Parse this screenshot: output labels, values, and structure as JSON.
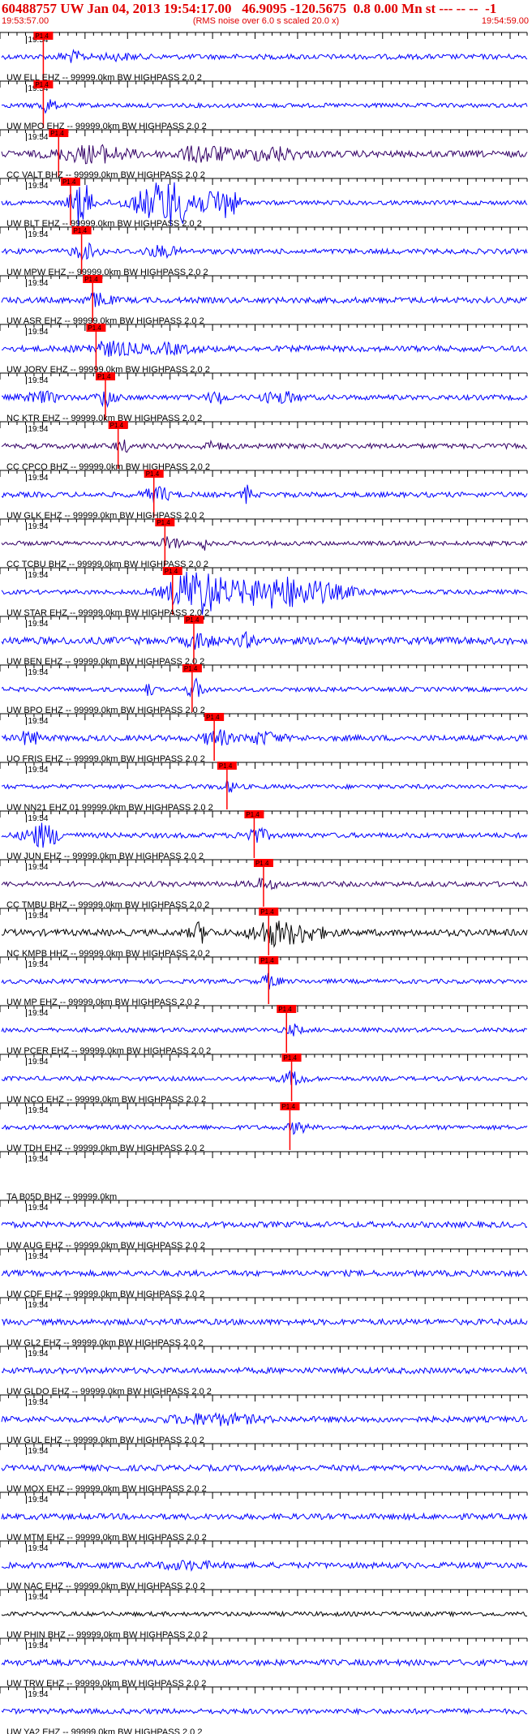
{
  "header": {
    "title": "60488757 UW Jan 04, 2013 19:54:17.00   46.9095 -120.5675  0.8 0.00 Mn st --- -- --  -1",
    "start_time": "19:53:57.00",
    "note": "(RMS noise over 6.0 s scaled 20.0 x)",
    "end_time": "19:54:59.00"
  },
  "colors": {
    "header_red": "#e00000",
    "trace_blue": "#0000ff",
    "trace_purple": "#330066",
    "trace_black": "#000000",
    "pick_red": "#ff0000"
  },
  "chart_data": {
    "type": "line",
    "x_range_seconds": [
      0,
      62
    ],
    "tick_label": "19:54",
    "pick_label": "P1.4",
    "traces": [
      {
        "label": "UW ELL EHZ -- 99999.0km BW  HIGHPASS  2.0  2",
        "color": "#0000ff",
        "pick": 5.0,
        "amp": 0.35,
        "bursts": [
          [
            8.5,
            1.5,
            0.6
          ],
          [
            14,
            2,
            0.3
          ]
        ]
      },
      {
        "label": "UW MPO EHZ -- 99999.0km BW  HIGHPASS  2.0  2",
        "color": "#0000ff",
        "pick": 5.0,
        "amp": 0.3,
        "bursts": [
          [
            5.5,
            1,
            0.9
          ]
        ]
      },
      {
        "label": "CC VALT BHZ -- 99999.0km BW  HIGHPASS  2.0  2",
        "color": "#330066",
        "pick": 6.8,
        "amp": 0.45,
        "bursts": [
          [
            11,
            4,
            1.0
          ],
          [
            24,
            3,
            1.0
          ],
          [
            32,
            3,
            0.8
          ]
        ]
      },
      {
        "label": "UW BLT EHZ -- 99999.0km BW  HIGHPASS  2.0  2",
        "color": "#0000ff",
        "pick": 8.2,
        "amp": 0.3,
        "bursts": [
          [
            9.5,
            1.2,
            3.0
          ],
          [
            20,
            4,
            3.0
          ],
          [
            26.5,
            1.5,
            2.0
          ]
        ]
      },
      {
        "label": "UW MPW EHZ -- 99999.0km BW  HIGHPASS  2.0  2",
        "color": "#0000ff",
        "pick": 9.5,
        "amp": 0.35,
        "bursts": [
          [
            10,
            1.5,
            0.9
          ],
          [
            19,
            2,
            0.6
          ]
        ]
      },
      {
        "label": "UW ASR EHZ -- 99999.0km BW  HIGHPASS  2.0  2",
        "color": "#0000ff",
        "pick": 10.8,
        "amp": 0.4,
        "bursts": [
          [
            11.5,
            1.5,
            0.8
          ]
        ]
      },
      {
        "label": "UW JORV EHZ -- 99999.0km BW  HIGHPASS  2.0  2",
        "color": "#0000ff",
        "pick": 11.2,
        "amp": 0.4,
        "bursts": [
          [
            13,
            3,
            0.8
          ],
          [
            20,
            3,
            0.5
          ]
        ]
      },
      {
        "label": "NC KTR EHZ -- 99999.0km BW  HIGHPASS  2.0  2",
        "color": "#0000ff",
        "pick": 12.3,
        "amp": 0.35,
        "bursts": [
          [
            5,
            2,
            0.6
          ],
          [
            12.5,
            1,
            1.2
          ],
          [
            25.5,
            1,
            0.8
          ],
          [
            33,
            2,
            0.7
          ]
        ]
      },
      {
        "label": "CC CPCO BHZ -- 99999.0km BW  HIGHPASS  2.0  2",
        "color": "#330066",
        "pick": 13.8,
        "amp": 0.35,
        "bursts": [
          [
            14.5,
            1,
            0.6
          ],
          [
            25,
            1.5,
            0.4
          ]
        ]
      },
      {
        "label": "UW GLK EHZ -- 99999.0km BW  HIGHPASS  2.0  2",
        "color": "#0000ff",
        "pick": 18.0,
        "amp": 0.35,
        "bursts": [
          [
            18.5,
            1.5,
            1.0
          ],
          [
            29,
            0.5,
            1.2
          ]
        ]
      },
      {
        "label": "CC TCBU BHZ -- 99999.0km BW  HIGHPASS  2.0  2",
        "color": "#330066",
        "pick": 19.3,
        "amp": 0.3,
        "bursts": [
          [
            20,
            1,
            1.0
          ],
          [
            24,
            0.5,
            0.8
          ]
        ]
      },
      {
        "label": "UW STAR EHZ -- 99999.0km BW  HIGHPASS  2.0  2",
        "color": "#0000ff",
        "pick": 20.2,
        "amp": 0.3,
        "bursts": [
          [
            23,
            3,
            3.0
          ],
          [
            33,
            7,
            2.0
          ]
        ]
      },
      {
        "label": "UW BEN EHZ -- 99999.0km BW  HIGHPASS  2.0  2",
        "color": "#0000ff",
        "pick": 22.7,
        "amp": 0.5,
        "bursts": [
          [
            23.5,
            1.5,
            0.9
          ],
          [
            29,
            1,
            0.7
          ]
        ]
      },
      {
        "label": "UW BPO EHZ -- 99999.0km BW  HIGHPASS  2.0  2",
        "color": "#0000ff",
        "pick": 22.5,
        "amp": 0.3,
        "bursts": [
          [
            23,
            1,
            1.2
          ],
          [
            17.5,
            0.5,
            0.8
          ]
        ]
      },
      {
        "label": "UO FRIS EHZ -- 99999.0km BW  HIGHPASS  2.0  2",
        "color": "#0000ff",
        "pick": 25.1,
        "amp": 0.4,
        "bursts": [
          [
            3.5,
            1,
            1.0
          ],
          [
            25.5,
            1.5,
            1.0
          ],
          [
            31,
            2,
            0.7
          ]
        ]
      },
      {
        "label": "UW NN21 EHZ 01 99999.0km BW  HIGHPASS  2.0  2",
        "color": "#0000ff",
        "pick": 26.6,
        "amp": 0.3,
        "bursts": [
          [
            27,
            1,
            0.6
          ]
        ]
      },
      {
        "label": "UW JUN EHZ -- 99999.0km BW  HIGHPASS  2.0  2",
        "color": "#0000ff",
        "pick": 29.8,
        "amp": 0.35,
        "bursts": [
          [
            5,
            2,
            1.5
          ],
          [
            30,
            1.5,
            0.9
          ]
        ]
      },
      {
        "label": "CC TMBU BHZ -- 99999.0km BW  HIGHPASS  2.0  2",
        "color": "#330066",
        "pick": 30.9,
        "amp": 0.35,
        "bursts": [
          [
            31,
            1.5,
            0.6
          ]
        ]
      },
      {
        "label": "NC KMPB HHZ -- 99999.0km BW  HIGHPASS  2.0  2",
        "color": "#000000",
        "pick": 31.5,
        "amp": 0.45,
        "bursts": [
          [
            23.5,
            1,
            1.2
          ],
          [
            31.5,
            2,
            1.2
          ],
          [
            35,
            3,
            1.1
          ]
        ]
      },
      {
        "label": "UW MP EHZ -- 99999.0km BW  HIGHPASS  2.0  2",
        "color": "#0000ff",
        "pick": 31.5,
        "amp": 0.3,
        "bursts": [
          [
            31.8,
            1,
            0.9
          ]
        ]
      },
      {
        "label": "UW PCER EHZ -- 99999.0km BW  HIGHPASS  2.0  2",
        "color": "#0000ff",
        "pick": 33.6,
        "amp": 0.3,
        "bursts": [
          [
            34.5,
            1,
            0.6
          ]
        ]
      },
      {
        "label": "UW NCO EHZ -- 99999.0km BW  HIGHPASS  2.0  2",
        "color": "#0000ff",
        "pick": 34.2,
        "amp": 0.3,
        "bursts": [
          [
            34.5,
            1.5,
            0.8
          ]
        ]
      },
      {
        "label": "UW TDH EHZ -- 99999.0km BW  HIGHPASS  2.0  2",
        "color": "#0000ff",
        "pick": 34.0,
        "amp": 0.3,
        "bursts": [
          [
            35,
            1,
            0.8
          ]
        ]
      },
      {
        "label": "TA B05D BHZ -- 99999.0km",
        "color": "#0000ff",
        "pick": null,
        "amp": 0.0,
        "bursts": []
      },
      {
        "label": "UW AUG EHZ -- 99999.0km BW  HIGHPASS  2.0  2",
        "color": "#0000ff",
        "pick": null,
        "amp": 0.4,
        "bursts": []
      },
      {
        "label": "UW CDF EHZ -- 99999.0km BW  HIGHPASS  2.0  2",
        "color": "#0000ff",
        "pick": null,
        "amp": 0.4,
        "bursts": []
      },
      {
        "label": "UW GL2 EHZ -- 99999.0km BW  HIGHPASS  2.0  2",
        "color": "#0000ff",
        "pick": null,
        "amp": 0.4,
        "bursts": []
      },
      {
        "label": "UW GLDO EHZ -- 99999.0km BW  HIGHPASS  2.0  2",
        "color": "#0000ff",
        "pick": null,
        "amp": 0.4,
        "bursts": []
      },
      {
        "label": "UW GUL EHZ -- 99999.0km BW  HIGHPASS  2.0  2",
        "color": "#0000ff",
        "pick": null,
        "amp": 0.4,
        "bursts": [
          [
            25,
            5,
            0.6
          ]
        ]
      },
      {
        "label": "UW MOX EHZ -- 99999.0km BW  HIGHPASS  2.0  2",
        "color": "#0000ff",
        "pick": null,
        "amp": 0.4,
        "bursts": []
      },
      {
        "label": "UW MTM EHZ -- 99999.0km BW  HIGHPASS  2.0  2",
        "color": "#0000ff",
        "pick": null,
        "amp": 0.4,
        "bursts": []
      },
      {
        "label": "UW NAC EHZ -- 99999.0km BW  HIGHPASS  2.0  2",
        "color": "#0000ff",
        "pick": null,
        "amp": 0.4,
        "bursts": [
          [
            22,
            3,
            0.4
          ]
        ]
      },
      {
        "label": "UW PHIN BHZ -- 99999.0km BW  HIGHPASS  2.0  2",
        "color": "#000000",
        "pick": null,
        "amp": 0.3,
        "bursts": []
      },
      {
        "label": "UW TRW EHZ -- 99999.0km BW  HIGHPASS  2.0  2",
        "color": "#0000ff",
        "pick": null,
        "amp": 0.4,
        "bursts": []
      },
      {
        "label": "UW YA2 EHZ -- 99999.0km BW  HIGHPASS  2.0  2",
        "color": "#0000ff",
        "pick": null,
        "amp": 0.35,
        "bursts": []
      }
    ]
  }
}
